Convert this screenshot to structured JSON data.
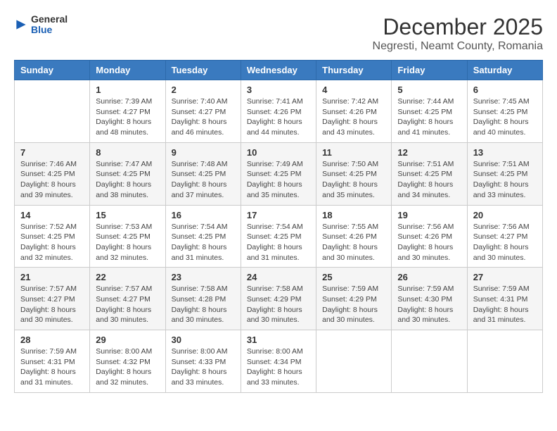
{
  "logo": {
    "general": "General",
    "blue": "Blue"
  },
  "header": {
    "title": "December 2025",
    "subtitle": "Negresti, Neamt County, Romania"
  },
  "weekdays": [
    "Sunday",
    "Monday",
    "Tuesday",
    "Wednesday",
    "Thursday",
    "Friday",
    "Saturday"
  ],
  "weeks": [
    [
      {
        "day": "",
        "info": ""
      },
      {
        "day": "1",
        "info": "Sunrise: 7:39 AM\nSunset: 4:27 PM\nDaylight: 8 hours\nand 48 minutes."
      },
      {
        "day": "2",
        "info": "Sunrise: 7:40 AM\nSunset: 4:27 PM\nDaylight: 8 hours\nand 46 minutes."
      },
      {
        "day": "3",
        "info": "Sunrise: 7:41 AM\nSunset: 4:26 PM\nDaylight: 8 hours\nand 44 minutes."
      },
      {
        "day": "4",
        "info": "Sunrise: 7:42 AM\nSunset: 4:26 PM\nDaylight: 8 hours\nand 43 minutes."
      },
      {
        "day": "5",
        "info": "Sunrise: 7:44 AM\nSunset: 4:25 PM\nDaylight: 8 hours\nand 41 minutes."
      },
      {
        "day": "6",
        "info": "Sunrise: 7:45 AM\nSunset: 4:25 PM\nDaylight: 8 hours\nand 40 minutes."
      }
    ],
    [
      {
        "day": "7",
        "info": "Sunrise: 7:46 AM\nSunset: 4:25 PM\nDaylight: 8 hours\nand 39 minutes."
      },
      {
        "day": "8",
        "info": "Sunrise: 7:47 AM\nSunset: 4:25 PM\nDaylight: 8 hours\nand 38 minutes."
      },
      {
        "day": "9",
        "info": "Sunrise: 7:48 AM\nSunset: 4:25 PM\nDaylight: 8 hours\nand 37 minutes."
      },
      {
        "day": "10",
        "info": "Sunrise: 7:49 AM\nSunset: 4:25 PM\nDaylight: 8 hours\nand 35 minutes."
      },
      {
        "day": "11",
        "info": "Sunrise: 7:50 AM\nSunset: 4:25 PM\nDaylight: 8 hours\nand 35 minutes."
      },
      {
        "day": "12",
        "info": "Sunrise: 7:51 AM\nSunset: 4:25 PM\nDaylight: 8 hours\nand 34 minutes."
      },
      {
        "day": "13",
        "info": "Sunrise: 7:51 AM\nSunset: 4:25 PM\nDaylight: 8 hours\nand 33 minutes."
      }
    ],
    [
      {
        "day": "14",
        "info": "Sunrise: 7:52 AM\nSunset: 4:25 PM\nDaylight: 8 hours\nand 32 minutes."
      },
      {
        "day": "15",
        "info": "Sunrise: 7:53 AM\nSunset: 4:25 PM\nDaylight: 8 hours\nand 32 minutes."
      },
      {
        "day": "16",
        "info": "Sunrise: 7:54 AM\nSunset: 4:25 PM\nDaylight: 8 hours\nand 31 minutes."
      },
      {
        "day": "17",
        "info": "Sunrise: 7:54 AM\nSunset: 4:25 PM\nDaylight: 8 hours\nand 31 minutes."
      },
      {
        "day": "18",
        "info": "Sunrise: 7:55 AM\nSunset: 4:26 PM\nDaylight: 8 hours\nand 30 minutes."
      },
      {
        "day": "19",
        "info": "Sunrise: 7:56 AM\nSunset: 4:26 PM\nDaylight: 8 hours\nand 30 minutes."
      },
      {
        "day": "20",
        "info": "Sunrise: 7:56 AM\nSunset: 4:27 PM\nDaylight: 8 hours\nand 30 minutes."
      }
    ],
    [
      {
        "day": "21",
        "info": "Sunrise: 7:57 AM\nSunset: 4:27 PM\nDaylight: 8 hours\nand 30 minutes."
      },
      {
        "day": "22",
        "info": "Sunrise: 7:57 AM\nSunset: 4:27 PM\nDaylight: 8 hours\nand 30 minutes."
      },
      {
        "day": "23",
        "info": "Sunrise: 7:58 AM\nSunset: 4:28 PM\nDaylight: 8 hours\nand 30 minutes."
      },
      {
        "day": "24",
        "info": "Sunrise: 7:58 AM\nSunset: 4:29 PM\nDaylight: 8 hours\nand 30 minutes."
      },
      {
        "day": "25",
        "info": "Sunrise: 7:59 AM\nSunset: 4:29 PM\nDaylight: 8 hours\nand 30 minutes."
      },
      {
        "day": "26",
        "info": "Sunrise: 7:59 AM\nSunset: 4:30 PM\nDaylight: 8 hours\nand 30 minutes."
      },
      {
        "day": "27",
        "info": "Sunrise: 7:59 AM\nSunset: 4:31 PM\nDaylight: 8 hours\nand 31 minutes."
      }
    ],
    [
      {
        "day": "28",
        "info": "Sunrise: 7:59 AM\nSunset: 4:31 PM\nDaylight: 8 hours\nand 31 minutes."
      },
      {
        "day": "29",
        "info": "Sunrise: 8:00 AM\nSunset: 4:32 PM\nDaylight: 8 hours\nand 32 minutes."
      },
      {
        "day": "30",
        "info": "Sunrise: 8:00 AM\nSunset: 4:33 PM\nDaylight: 8 hours\nand 33 minutes."
      },
      {
        "day": "31",
        "info": "Sunrise: 8:00 AM\nSunset: 4:34 PM\nDaylight: 8 hours\nand 33 minutes."
      },
      {
        "day": "",
        "info": ""
      },
      {
        "day": "",
        "info": ""
      },
      {
        "day": "",
        "info": ""
      }
    ]
  ]
}
